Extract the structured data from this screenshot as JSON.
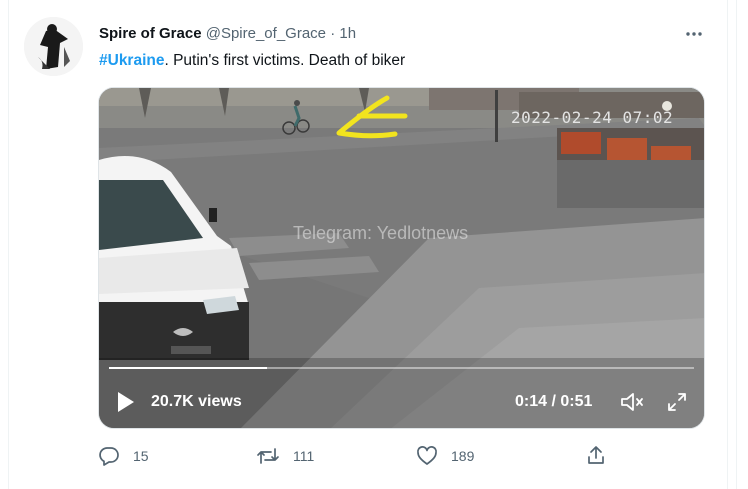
{
  "tweet": {
    "author_name": "Spire of Grace",
    "handle": "@Spire_of_Grace",
    "separator": "·",
    "time": "1h",
    "hashtag": "#Ukraine",
    "text_rest": ".  Putin's first victims. Death of biker"
  },
  "video": {
    "overlay_timestamp": "2022-02-24 07:02",
    "watermark": "Telegram: Yedlotnews",
    "views_label": "20.7K views",
    "time_label": "0:14 / 0:51",
    "progress_fraction": 0.27
  },
  "actions": {
    "reply_count": "15",
    "retweet_count": "111",
    "like_count": "189"
  },
  "icons": {
    "more": "more-dots-icon",
    "play": "play-icon",
    "volume": "volume-muted-icon",
    "fullscreen": "fullscreen-icon",
    "reply": "reply-icon",
    "retweet": "retweet-icon",
    "like": "heart-icon",
    "share": "share-icon"
  },
  "colors": {
    "accent": "#1d9bf0",
    "muted_text": "#536471",
    "body_text": "#0f1419",
    "annotation_arrow": "#f2e41e"
  }
}
